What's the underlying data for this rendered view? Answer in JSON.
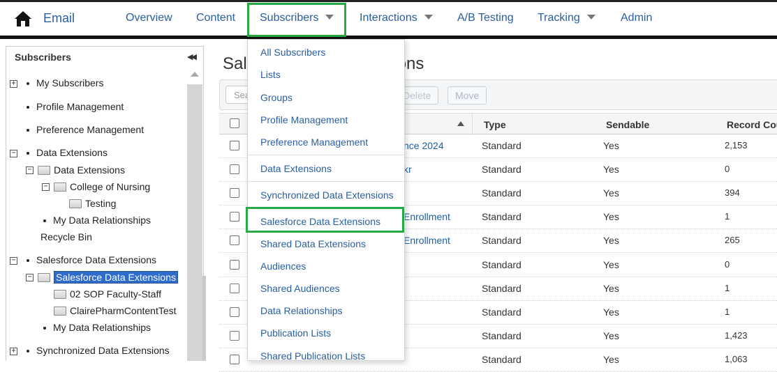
{
  "topbar": {
    "brand": "Email",
    "nav": [
      {
        "label": "Overview"
      },
      {
        "label": "Content"
      },
      {
        "label": "Subscribers"
      },
      {
        "label": "Interactions"
      },
      {
        "label": "A/B Testing"
      },
      {
        "label": "Tracking"
      },
      {
        "label": "Admin"
      }
    ]
  },
  "sidebar": {
    "title": "Subscribers",
    "items": [
      {
        "label": "My Subscribers"
      },
      {
        "label": "Profile Management"
      },
      {
        "label": "Preference Management"
      },
      {
        "label": "Data Extensions"
      },
      {
        "label": "Data Extensions"
      },
      {
        "label": "College of Nursing"
      },
      {
        "label": "Testing"
      },
      {
        "label": "My Data Relationships"
      },
      {
        "label": "Recycle Bin"
      },
      {
        "label": "Salesforce Data Extensions"
      },
      {
        "label": "Salesforce Data Extensions"
      },
      {
        "label": "02 SOP Faculty-Staff"
      },
      {
        "label": "ClairePharmContentTest"
      },
      {
        "label": "My Data Relationships"
      },
      {
        "label": "Synchronized Data Extensions"
      }
    ]
  },
  "main": {
    "title_left": "Sal",
    "title_right": "ons",
    "search_placeholder": "Sea",
    "buttons": {
      "delete": "Delete",
      "move": "Move"
    },
    "columns": {
      "type": "Type",
      "sendable": "Sendable",
      "record_count": "Record Cou"
    },
    "rows": [
      {
        "name": "nce 2024",
        "type": "Standard",
        "sendable": "Yes",
        "count": "2,153"
      },
      {
        "name": "kr",
        "type": "Standard",
        "sendable": "Yes",
        "count": "0"
      },
      {
        "name": "",
        "type": "Standard",
        "sendable": "Yes",
        "count": "394"
      },
      {
        "name": "Enrollment",
        "type": "Standard",
        "sendable": "Yes",
        "count": "1"
      },
      {
        "name": "Enrollment",
        "type": "Standard",
        "sendable": "Yes",
        "count": "265"
      },
      {
        "name": "",
        "type": "Standard",
        "sendable": "Yes",
        "count": "0"
      },
      {
        "name": "",
        "type": "Standard",
        "sendable": "Yes",
        "count": "1"
      },
      {
        "name": "",
        "type": "Standard",
        "sendable": "Yes",
        "count": "1"
      },
      {
        "name": "",
        "type": "Standard",
        "sendable": "Yes",
        "count": "1,423"
      },
      {
        "name": "",
        "type": "Standard",
        "sendable": "Yes",
        "count": "1,063"
      }
    ]
  },
  "dropdown": {
    "items": [
      "All Subscribers",
      "Lists",
      "Groups",
      "Profile Management",
      "Preference Management",
      "Data Extensions",
      "Synchronized Data Extensions",
      "Salesforce Data Extensions",
      "Shared Data Extensions",
      "Audiences",
      "Shared Audiences",
      "Data Relationships",
      "Publication Lists",
      "Shared Publication Lists"
    ]
  },
  "colors": {
    "link": "#2a5e9e",
    "highlight": "#27a843",
    "selected": "#2e6ccb"
  }
}
